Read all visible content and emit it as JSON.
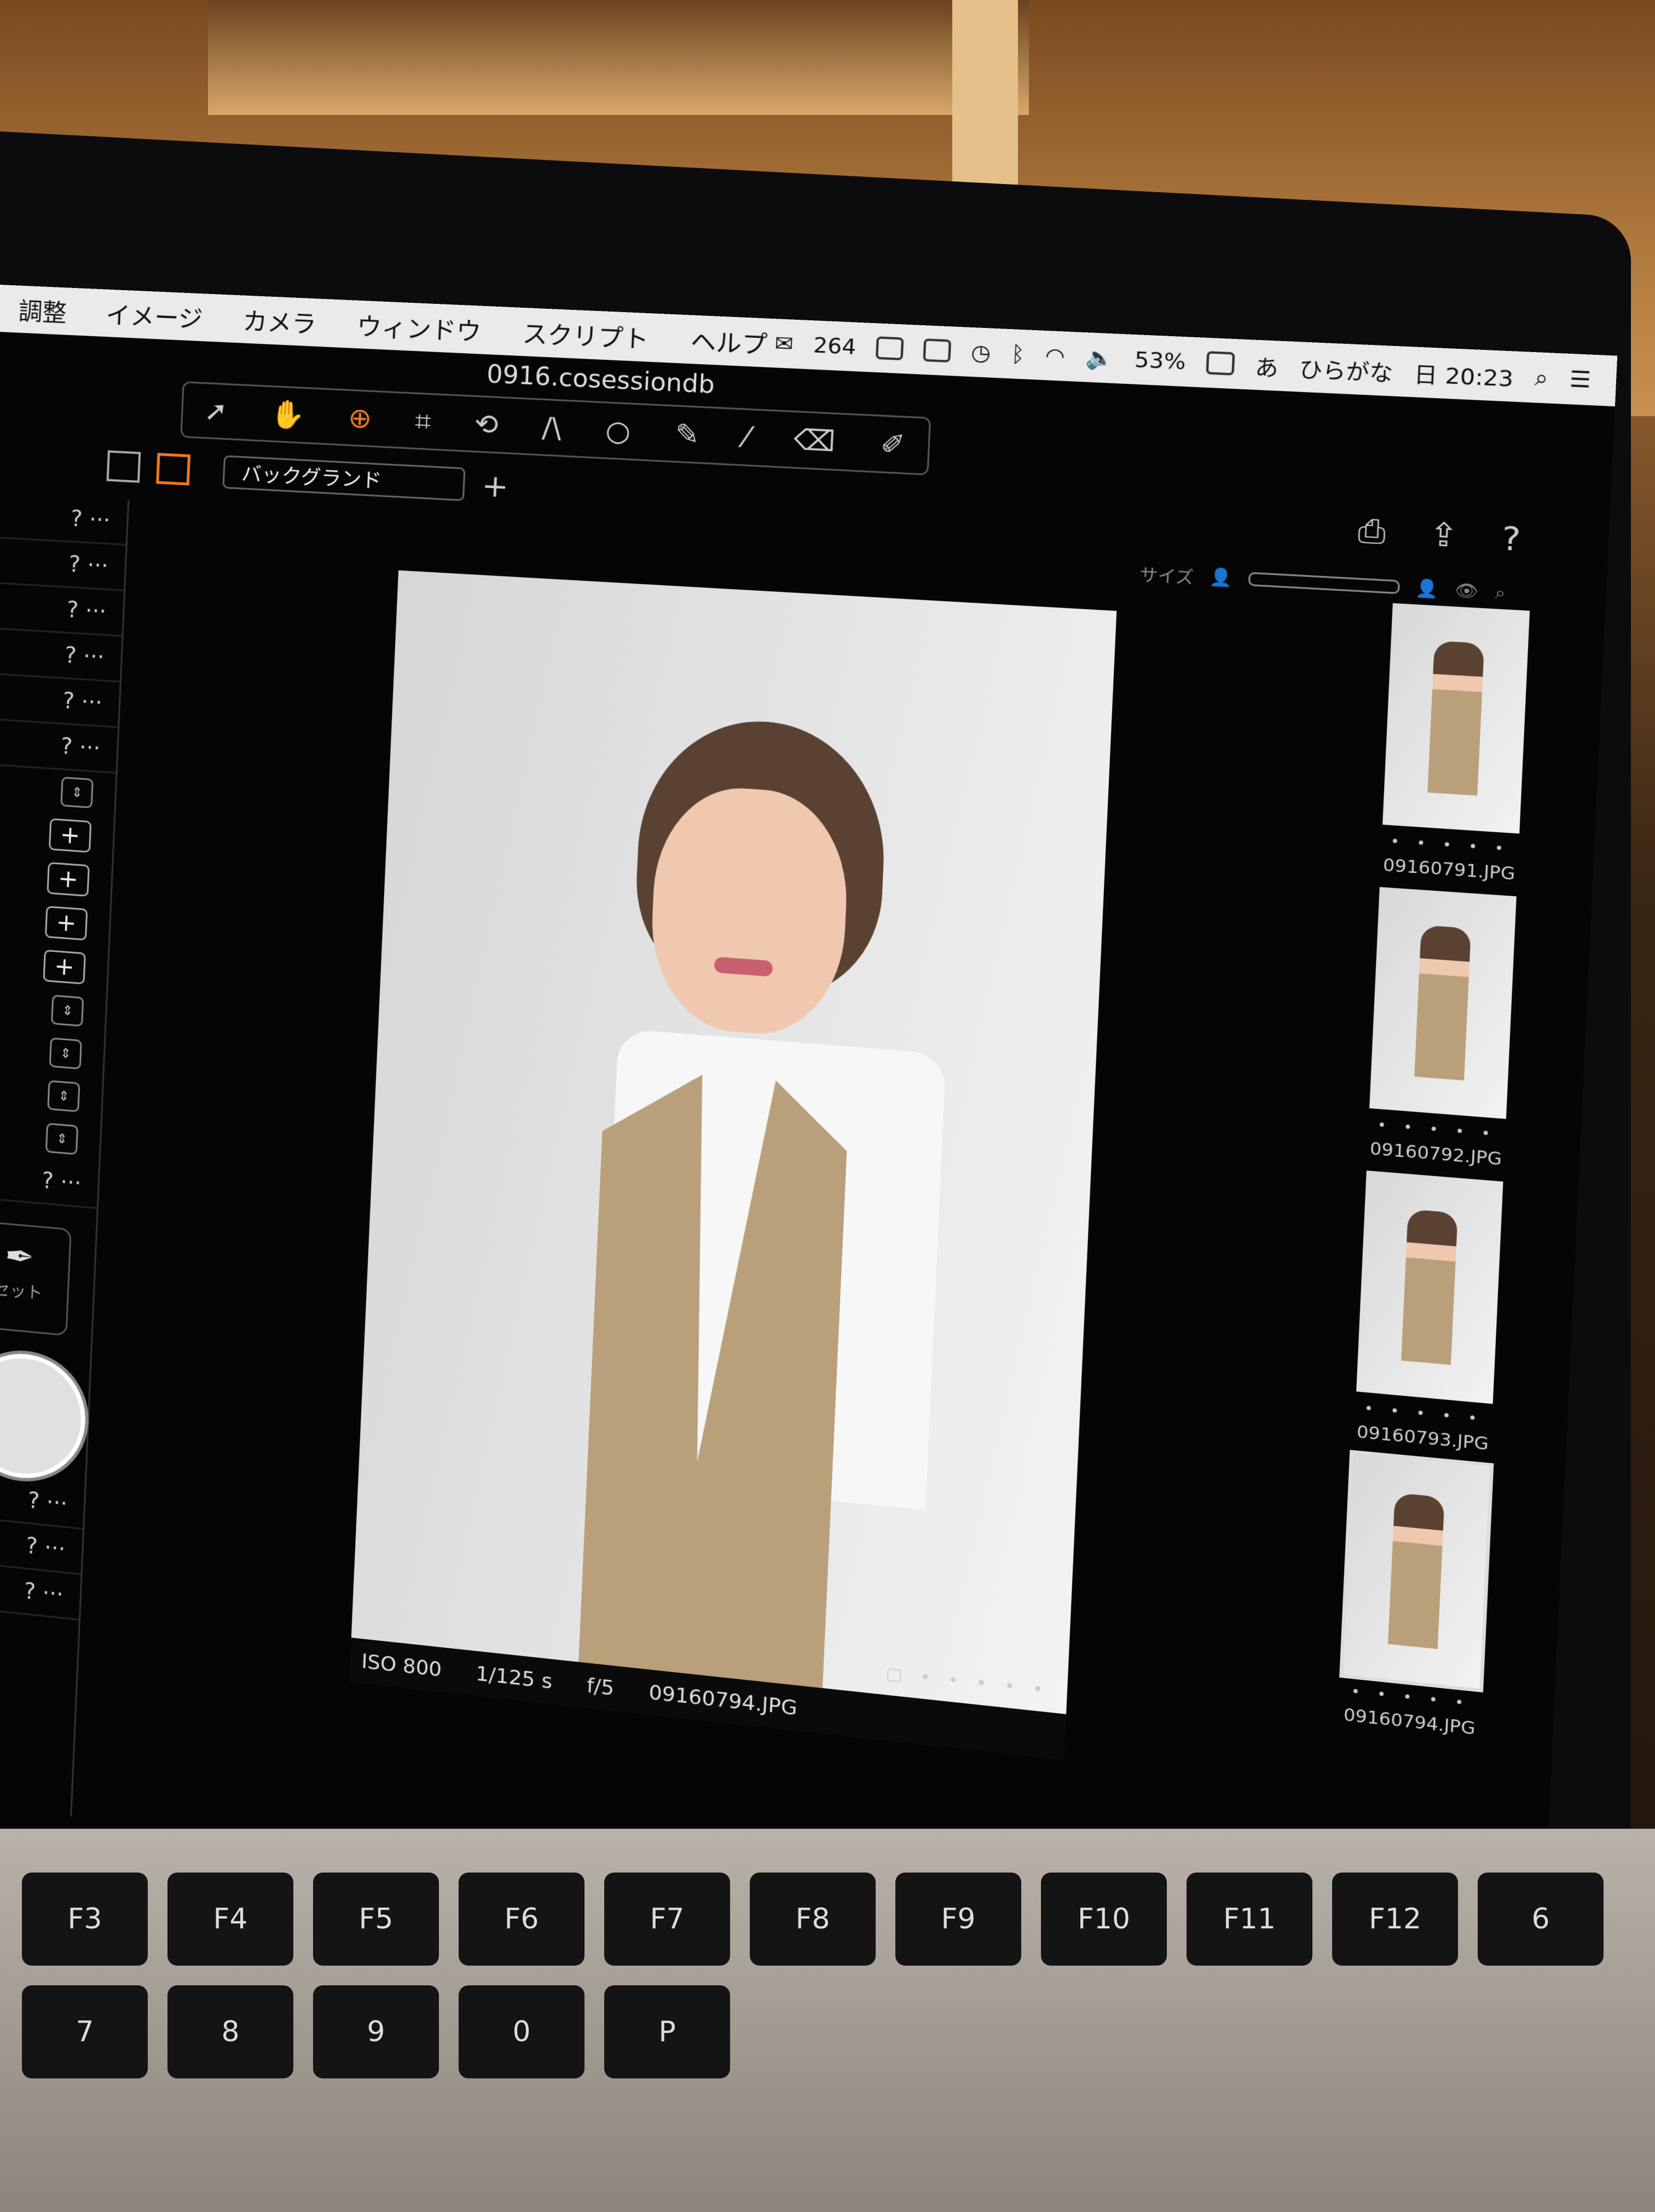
{
  "menubar": {
    "items": [
      "調整",
      "イメージ",
      "カメラ",
      "ウィンドウ",
      "スクリプト",
      "ヘルプ"
    ],
    "mail_count": "264",
    "battery": "53%",
    "input_mode": "ひらがな",
    "clock": "日 20:23"
  },
  "window": {
    "title": "0916.cosessiondb"
  },
  "toolbar2": {
    "preset_dropdown": "バックグランド",
    "size_label": "サイズ"
  },
  "left_panel": {
    "help": "? ···",
    "set_label": "セット"
  },
  "viewer": {
    "iso": "ISO 800",
    "shutter": "1/125 s",
    "aperture": "f/5",
    "filename": "09160794.JPG"
  },
  "thumbnails": [
    {
      "name": "09160791.JPG",
      "rating": "• • • • •",
      "selected": false
    },
    {
      "name": "09160792.JPG",
      "rating": "• • • • •",
      "selected": false
    },
    {
      "name": "09160793.JPG",
      "rating": "• • • • •",
      "selected": false
    },
    {
      "name": "09160794.JPG",
      "rating": "• • • • •",
      "selected": true
    }
  ],
  "keyboard": {
    "keys": [
      "F3",
      "F4",
      "F5",
      "F6",
      "F7",
      "F8",
      "F9",
      "F10",
      "F11",
      "F12",
      "6",
      "7",
      "8",
      "9",
      "0",
      "P"
    ]
  }
}
